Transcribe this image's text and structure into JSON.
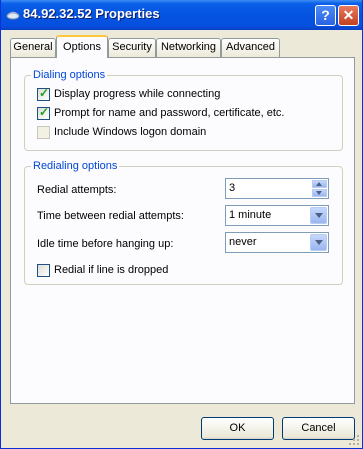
{
  "window": {
    "title": "84.92.32.52 Properties",
    "help_label": "?",
    "close_label": "✕"
  },
  "tabs": [
    {
      "label": "General",
      "active": false
    },
    {
      "label": "Options",
      "active": true
    },
    {
      "label": "Security",
      "active": false
    },
    {
      "label": "Networking",
      "active": false
    },
    {
      "label": "Advanced",
      "active": false
    }
  ],
  "dialing": {
    "legend": "Dialing options",
    "options": [
      {
        "label": "Display progress while connecting",
        "checked": true,
        "enabled": true
      },
      {
        "label": "Prompt for name and password, certificate, etc.",
        "checked": true,
        "enabled": true
      },
      {
        "label": "Include Windows logon domain",
        "checked": false,
        "enabled": false
      }
    ]
  },
  "redialing": {
    "legend": "Redialing options",
    "attempts_label": "Redial attempts:",
    "attempts_value": "3",
    "time_label": "Time between redial attempts:",
    "time_value": "1 minute",
    "idle_label": "Idle time before hanging up:",
    "idle_value": "never",
    "redial_dropped_label": "Redial if line is dropped",
    "redial_dropped_checked": false
  },
  "buttons": {
    "ok": "OK",
    "cancel": "Cancel"
  },
  "check_glyph": "✓",
  "colors": {
    "titlebar": "#0553e1",
    "legend": "#0046d5",
    "face": "#ece9d8"
  }
}
